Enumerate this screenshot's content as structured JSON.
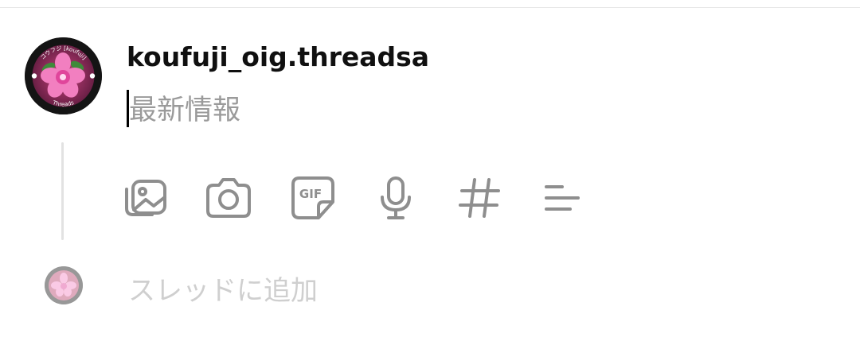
{
  "header": {
    "username": "koufuji_oig.threadsa"
  },
  "avatar": {
    "ring_text_top": "コウフジ [koufuji]",
    "ring_text_bottom": "Threads"
  },
  "compose": {
    "placeholder": "最新情報",
    "value": ""
  },
  "toolbar": {
    "icons": [
      "gallery-icon",
      "camera-icon",
      "gif-icon",
      "microphone-icon",
      "hashtag-icon",
      "poll-icon"
    ],
    "gif_label": "GIF"
  },
  "thread": {
    "add_label": "スレッドに追加"
  },
  "colors": {
    "icon_gray": "#8e8e8e",
    "placeholder_gray": "#9a9a9a",
    "add_thread_gray": "#cfcfcf",
    "flower_pink": "#e0459b"
  }
}
